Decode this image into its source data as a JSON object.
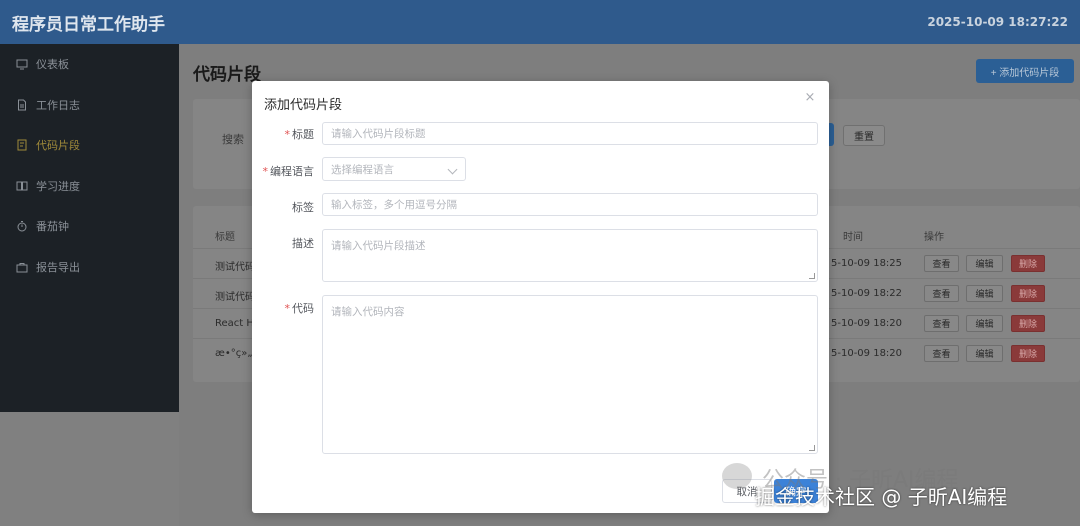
{
  "header": {
    "title": "程序员日常工作助手",
    "datetime": "2025-10-09 18:27:22"
  },
  "sidebar": {
    "items": [
      {
        "label": "仪表板",
        "icon": "dashboard-icon",
        "active": false
      },
      {
        "label": "工作日志",
        "icon": "document-icon",
        "active": false
      },
      {
        "label": "代码片段",
        "icon": "snippet-icon",
        "active": true
      },
      {
        "label": "学习进度",
        "icon": "book-icon",
        "active": false
      },
      {
        "label": "番茄钟",
        "icon": "timer-icon",
        "active": false
      },
      {
        "label": "报告导出",
        "icon": "briefcase-icon",
        "active": false
      }
    ]
  },
  "page": {
    "title": "代码片段",
    "add_button": "+ 添加代码片段",
    "search_label": "搜索",
    "reset_button": "重置",
    "table": {
      "headers": {
        "title": "标题",
        "time": "时间",
        "actions": "操作"
      },
      "rows": [
        {
          "title": "测试代码",
          "time": "5-10-09 18:25"
        },
        {
          "title": "测试代码",
          "time": "5-10-09 18:22"
        },
        {
          "title": "React H",
          "time": "5-10-09 18:20"
        },
        {
          "title": "æ•°ç»„åŽ",
          "time": "5-10-09 18:20"
        }
      ],
      "action_view": "查看",
      "action_edit": "编辑",
      "action_delete": "删除"
    }
  },
  "modal": {
    "title": "添加代码片段",
    "close": "×",
    "fields": {
      "title": {
        "label": "标题",
        "placeholder": "请输入代码片段标题",
        "required": true
      },
      "language": {
        "label": "编程语言",
        "placeholder": "选择编程语言",
        "required": true
      },
      "tags": {
        "label": "标签",
        "placeholder": "输入标签，多个用逗号分隔",
        "required": false
      },
      "description": {
        "label": "描述",
        "placeholder": "请输入代码片段描述",
        "required": false
      },
      "code": {
        "label": "代码",
        "placeholder": "请输入代码内容",
        "required": true
      }
    },
    "cancel_button": "取消",
    "confirm_button": "确定"
  },
  "watermark": {
    "line1": "公众号 · 子昕AI编程",
    "line2": "掘金技术社区 @ 子昕AI编程"
  },
  "colors": {
    "header": "#2f5a8c",
    "sidebar": "#1c2126",
    "active_nav": "#a08a3a",
    "primary": "#3c82d8",
    "danger": "#e05252"
  }
}
